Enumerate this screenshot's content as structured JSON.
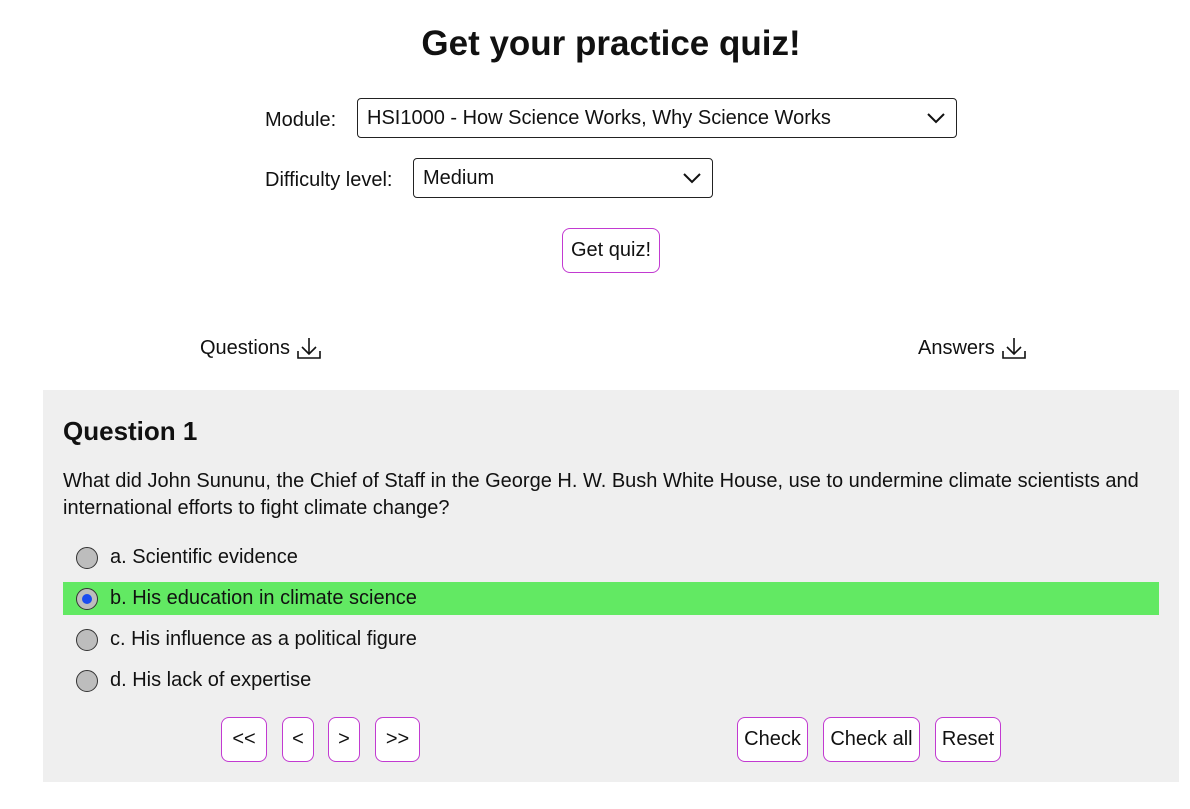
{
  "header": {
    "title": "Get your practice quiz!"
  },
  "form": {
    "module_label": "Module:",
    "module_value": "HSI1000 - How Science Works, Why Science Works",
    "difficulty_label": "Difficulty level:",
    "difficulty_value": "Medium",
    "submit_label": "Get quiz!"
  },
  "downloads": {
    "questions_label": "Questions",
    "answers_label": "Answers"
  },
  "quiz": {
    "heading": "Question 1",
    "question": "What did John Sununu, the Chief of Staff in the George H. W. Bush White House, use to undermine climate scientists and international efforts to fight climate change?",
    "options": [
      {
        "label": "a. Scientific evidence",
        "selected": false
      },
      {
        "label": "b. His education in climate science",
        "selected": true
      },
      {
        "label": "c. His influence as a political figure",
        "selected": false
      },
      {
        "label": "d. His lack of expertise",
        "selected": false
      }
    ],
    "highlight_color": "#62e963",
    "nav": {
      "first": "<<",
      "prev": "<",
      "next": ">",
      "last": ">>"
    },
    "actions": {
      "check": "Check",
      "check_all": "Check all",
      "reset": "Reset"
    }
  },
  "colors": {
    "button_border": "#c23ad1",
    "panel_bg": "#efefef",
    "radio_dot": "#1a4cf0"
  }
}
